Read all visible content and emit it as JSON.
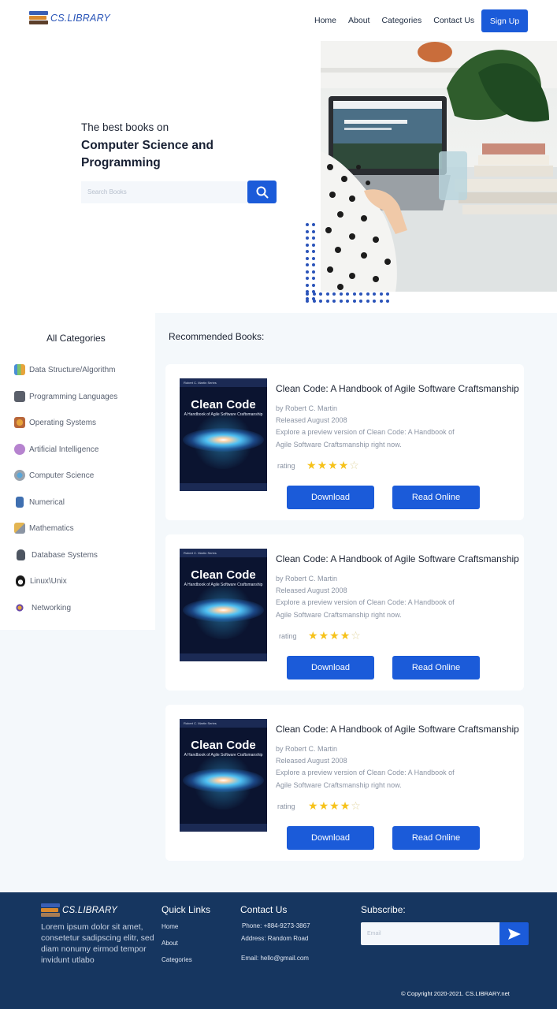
{
  "nav": {
    "logo": "CS.LIBRARY",
    "links": [
      "Home",
      "About",
      "Categories",
      "Contact Us"
    ],
    "signup": "Sign Up"
  },
  "hero": {
    "subtitle": "The best books on",
    "title": "Computer Science and Programming",
    "search_placeholder": "Search Books"
  },
  "sidebar": {
    "title": "All Categories",
    "items": [
      {
        "label": "Data Structure/Algorithm",
        "icon": "chart-icon"
      },
      {
        "label": "Programming Languages",
        "icon": "code-window-icon"
      },
      {
        "label": "Operating Systems",
        "icon": "os-grid-icon"
      },
      {
        "label": "Artificial Intelligence",
        "icon": "brain-icon"
      },
      {
        "label": "Computer Science",
        "icon": "network-icon"
      },
      {
        "label": "Numerical",
        "icon": "calculator-icon"
      },
      {
        "label": "Mathematics",
        "icon": "ruler-pencil-icon"
      },
      {
        "label": "Database Systems",
        "icon": "database-icon"
      },
      {
        "label": "Linux\\Unix",
        "icon": "penguin-icon"
      },
      {
        "label": "Networking",
        "icon": "network-nodes-icon"
      }
    ]
  },
  "recommended": {
    "title": "Recommended Books:",
    "books": [
      {
        "title": "Clean Code: A Handbook of Agile Software Craftsmanship",
        "author": "by Robert C. Martin",
        "released": "Released August 2008",
        "desc1": "Explore a preview version of Clean Code: A Handbook of",
        "desc2": "Agile Software Craftsmanship right now.",
        "rating_label": "rating",
        "rating": 4,
        "rating_max": 5,
        "cover": {
          "series": "Robert C. Martin Series",
          "title": "Clean Code",
          "subtitle": "A Handbook of Agile Software Craftsmanship"
        },
        "download": "Download",
        "read": "Read Online"
      },
      {
        "title": "Clean Code: A Handbook of Agile Software Craftsmanship",
        "author": "by Robert C. Martin",
        "released": "Released August 2008",
        "desc1": "Explore a preview version of Clean Code: A Handbook of",
        "desc2": "Agile Software Craftsmanship right now.",
        "rating_label": "rating",
        "rating": 4,
        "rating_max": 5,
        "cover": {
          "series": "Robert C. Martin Series",
          "title": "Clean Code",
          "subtitle": "A Handbook of Agile Software Craftsmanship"
        },
        "download": "Download",
        "read": "Read Online"
      },
      {
        "title": "Clean Code: A Handbook of Agile Software Craftsmanship",
        "author": "by Robert C. Martin",
        "released": "Released August 2008",
        "desc1": "Explore a preview version of Clean Code: A Handbook of",
        "desc2": "Agile Software Craftsmanship right now.",
        "rating_label": "rating",
        "rating": 4,
        "rating_max": 5,
        "cover": {
          "series": "Robert C. Martin Series",
          "title": "Clean Code",
          "subtitle": "A Handbook of Agile Software Craftsmanship"
        },
        "download": "Download",
        "read": "Read Online"
      }
    ]
  },
  "footer": {
    "logo": "CS.LIBRARY",
    "lorem": "Lorem ipsum dolor sit amet, consetetur sadipscing elitr, sed diam nonumy eirmod tempor invidunt utlabo",
    "quick_links_title": "Quick Links",
    "quick_links": [
      "Home",
      "About",
      "Categories"
    ],
    "contact_title": "Contact Us",
    "phone": "Phone: +884-9273-3867",
    "address": "Address: Random Road",
    "email": "Email: hello@gmail.com",
    "subscribe_title": "Subscribe:",
    "subscribe_placeholder": "Email",
    "copyright": "© Copyright 2020-2021. CS.LIBRARY.net"
  },
  "colors": {
    "primary": "#1b5bd9",
    "footer_bg": "#163660",
    "star": "#f6c21a"
  }
}
